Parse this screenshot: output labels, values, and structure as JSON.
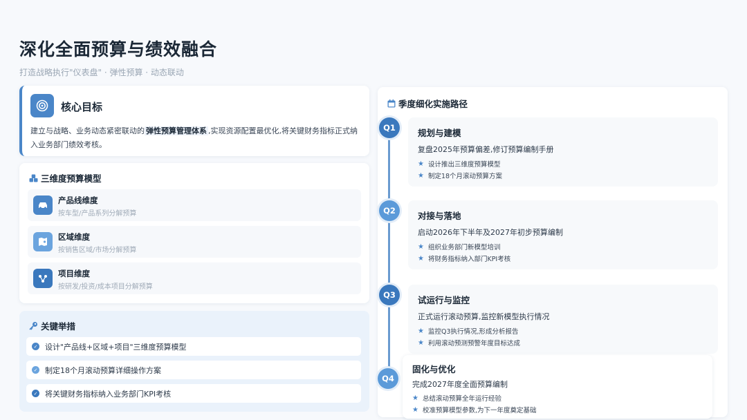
{
  "header": {
    "title": "深化全面预算与绩效融合",
    "subtitle": "打造战略执行\"仪表盘\" · 弹性预算 · 动态联动"
  },
  "core": {
    "title": "核心目标",
    "desc_pre": "建立与战略、业务动态紧密联动的",
    "desc_highlight": "弹性预算管理体系",
    "desc_post": ",实现资源配置最优化,将关键财务指标正式纳入业务部门绩效考核。"
  },
  "model": {
    "title": "三维度预算模型",
    "items": [
      {
        "title": "产品线维度",
        "sub": "按车型/产品系列分解预算",
        "icon": "car-icon"
      },
      {
        "title": "区域维度",
        "sub": "按销售区域/市场分解预算",
        "icon": "region-icon"
      },
      {
        "title": "项目维度",
        "sub": "按研发/投资/成本项目分解预算",
        "icon": "project-icon"
      }
    ]
  },
  "measures": {
    "title": "关键举措",
    "items": [
      "设计\"产品线+区域+项目\"三维度预算模型",
      "制定18个月滚动预算详细操作方案",
      "将关键财务指标纳入业务部门KPI考核"
    ]
  },
  "route": {
    "title": "季度细化实施路径",
    "phases": [
      {
        "q": "Q1",
        "title": "规划与建模",
        "desc": "复盘2025年预算偏差,修订预算编制手册",
        "items": [
          "设计推出三维度预算模型",
          "制定18个月滚动预算方案"
        ]
      },
      {
        "q": "Q2",
        "title": "对接与落地",
        "desc": "启动2026年下半年及2027年初步预算编制",
        "items": [
          "组织业务部门新模型培训",
          "将财务指标纳入部门KPI考核"
        ]
      },
      {
        "q": "Q3",
        "title": "试运行与监控",
        "desc": "正式运行滚动预算,监控新模型执行情况",
        "items": [
          "监控Q3执行情况,形成分析报告",
          "利用滚动预测预警年度目标达成"
        ]
      },
      {
        "q": "Q4",
        "title": "固化与优化",
        "desc": "完成2027年度全面预算编制",
        "items": [
          "总结滚动预算全年运行经验",
          "校准预算模型参数,为下一年度奠定基础"
        ]
      }
    ]
  },
  "colors": {
    "accent": "#4a86c8",
    "dark_badge": "#3a78bd",
    "light_badge": "#5b9ad9"
  }
}
